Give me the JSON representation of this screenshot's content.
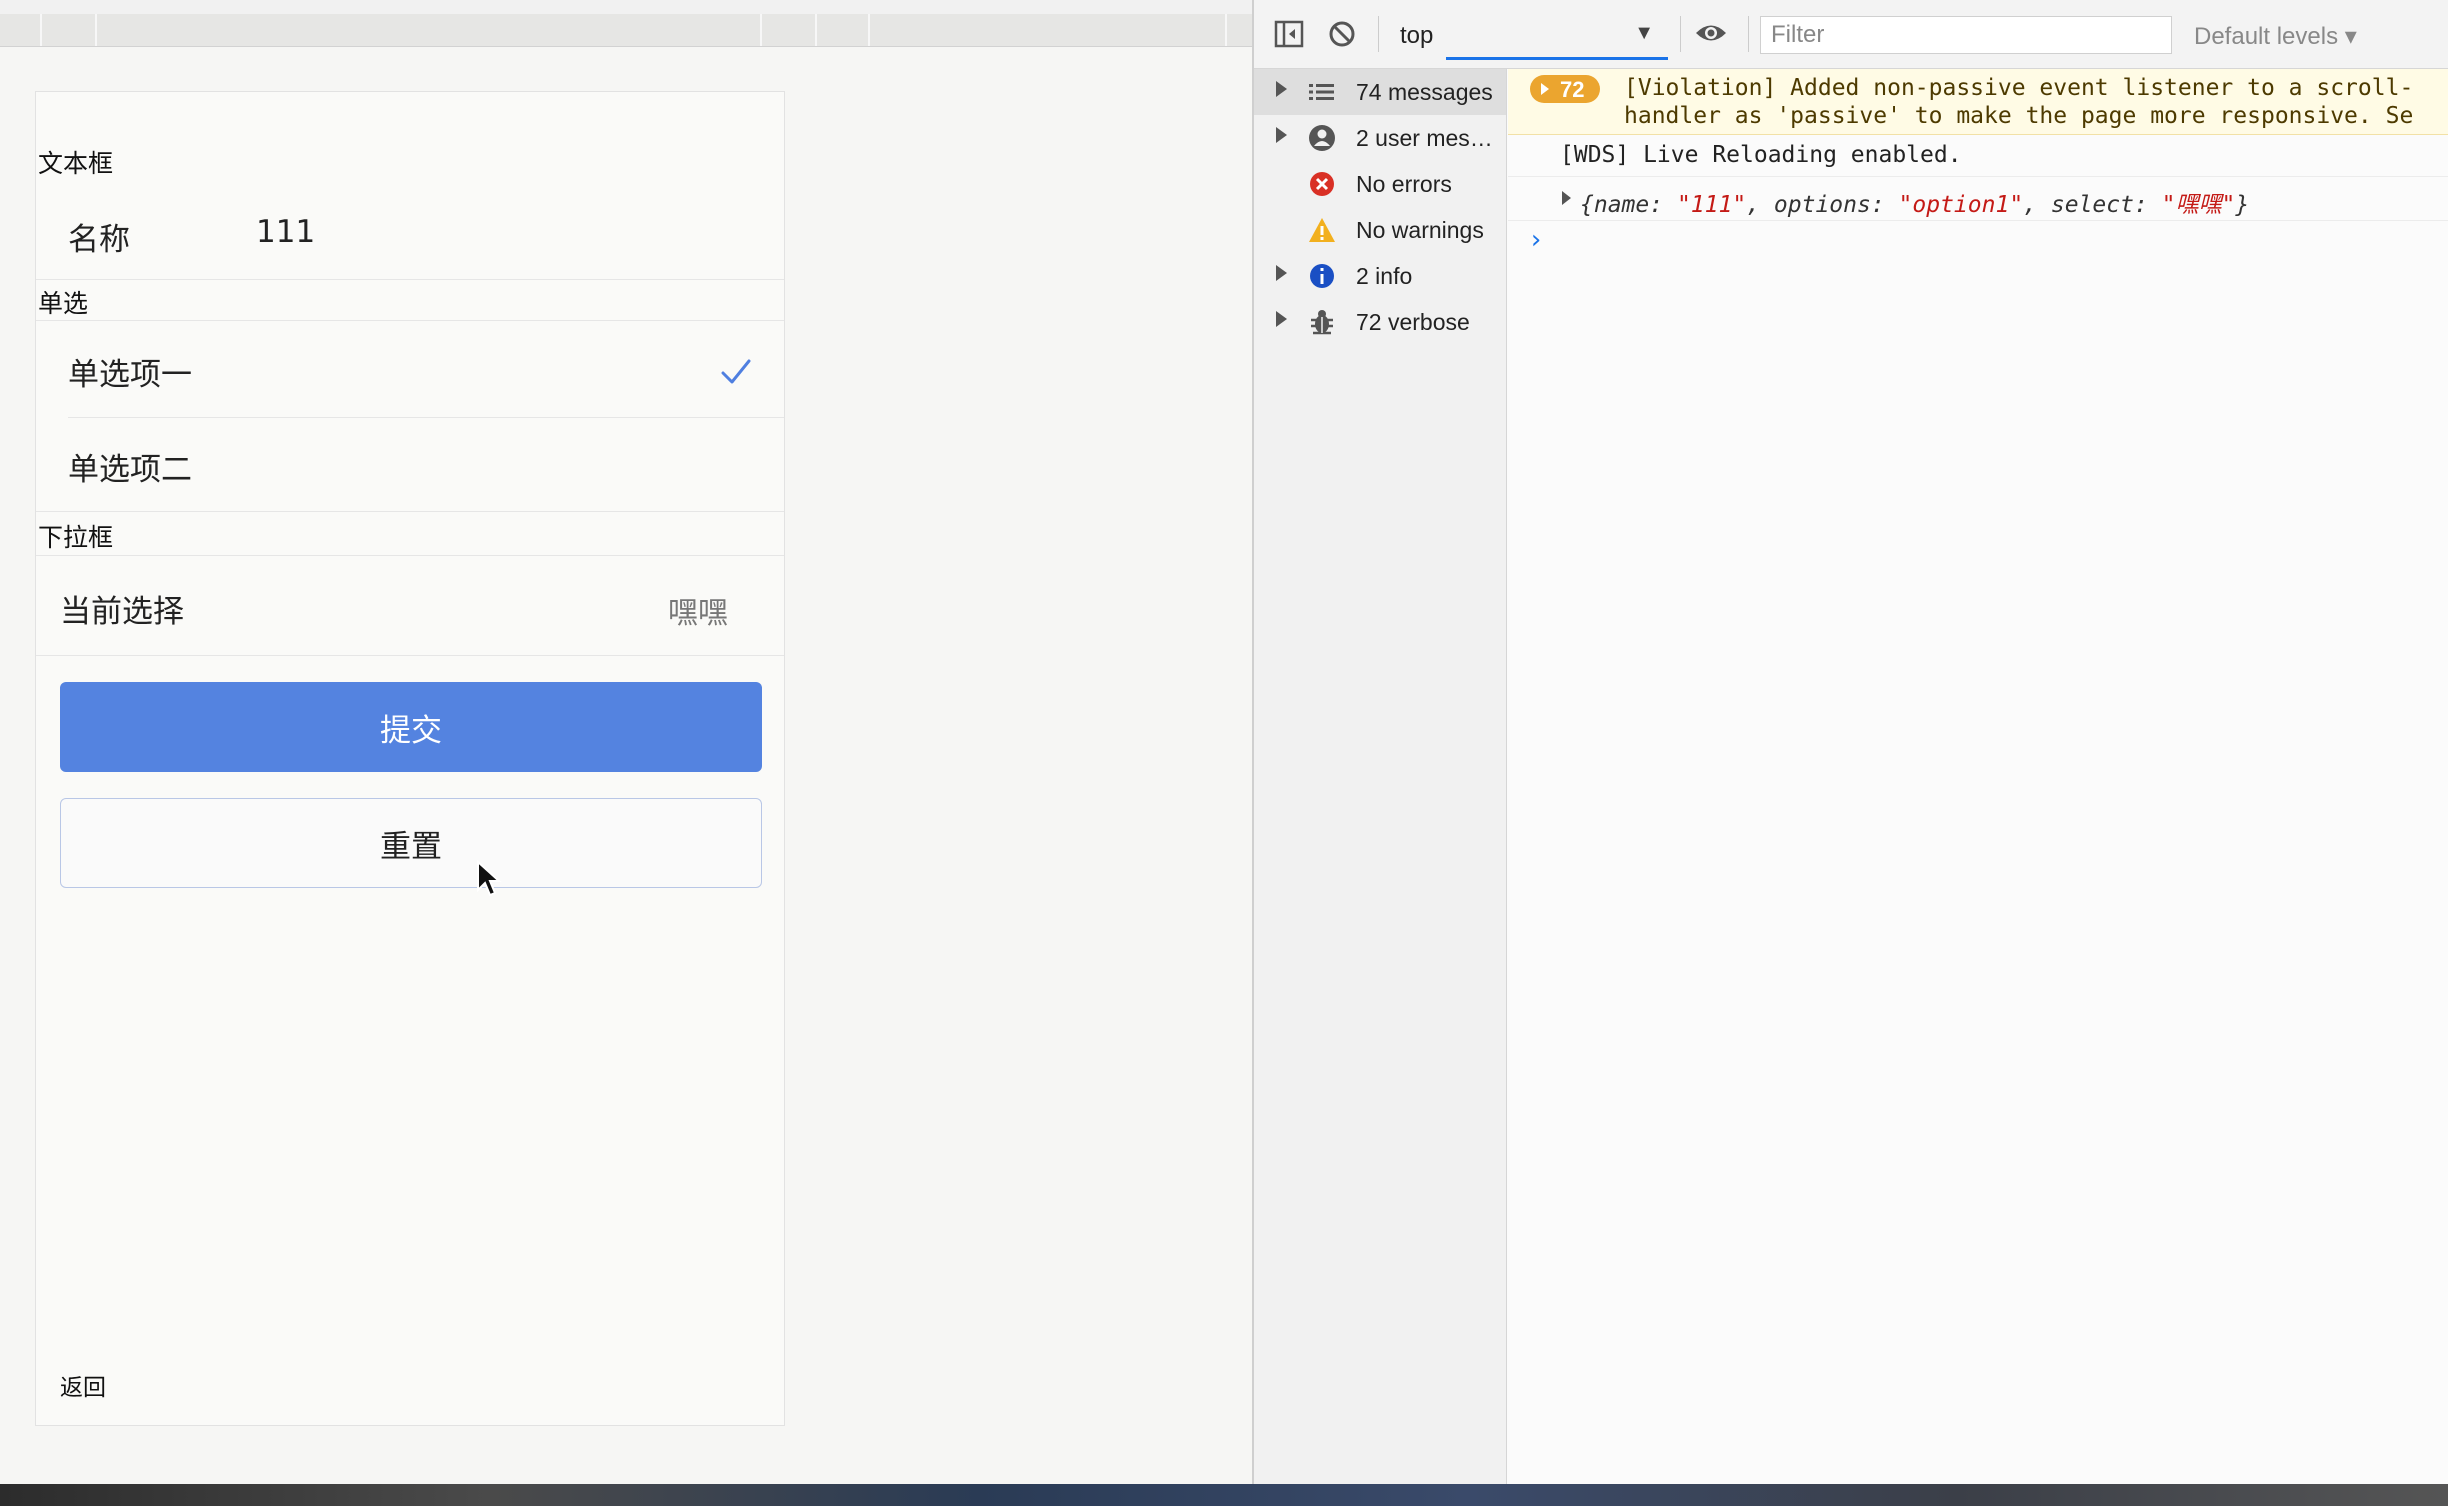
{
  "app": {
    "form": {
      "textbox_section": "文本框",
      "name_label": "名称",
      "name_value": "111",
      "radio_section": "单选",
      "radio_options": [
        {
          "label": "单选项一",
          "checked": true
        },
        {
          "label": "单选项二",
          "checked": false
        }
      ],
      "select_section": "下拉框",
      "select_label": "当前选择",
      "select_value": "嘿嘿",
      "submit_label": "提交",
      "reset_label": "重置",
      "back_label": "返回"
    }
  },
  "devtools": {
    "context": "top",
    "filter_placeholder": "Filter",
    "levels_label": "Default levels ▾",
    "sidebar": [
      {
        "label": "74 messages",
        "icon": "list-icon",
        "expandable": true,
        "selected": true
      },
      {
        "label": "2 user mes…",
        "icon": "user-icon",
        "expandable": true,
        "selected": false
      },
      {
        "label": "No errors",
        "icon": "error-icon",
        "expandable": false,
        "selected": false
      },
      {
        "label": "No warnings",
        "icon": "warning-icon",
        "expandable": false,
        "selected": false
      },
      {
        "label": "2 info",
        "icon": "info-icon",
        "expandable": true,
        "selected": false
      },
      {
        "label": "72 verbose",
        "icon": "bug-icon",
        "expandable": true,
        "selected": false
      }
    ],
    "console": {
      "violation_count": "72",
      "violation_line1": "[Violation] Added non-passive event listener to a scroll-",
      "violation_line2": "handler as 'passive' to make the page more responsive. Se",
      "wds_message": "[WDS] Live Reloading enabled.",
      "object_log": {
        "name_key": "name",
        "name_value": "\"111\"",
        "options_key": "options",
        "options_value": "\"option1\"",
        "select_key": "select",
        "select_value": "\"嘿嘿\""
      },
      "prompt": "›"
    },
    "colors": {
      "accent": "#1a73e8",
      "violation_bg": "#fffbe5",
      "badge": "#eba52f",
      "submit_button": "#5483e0"
    }
  }
}
